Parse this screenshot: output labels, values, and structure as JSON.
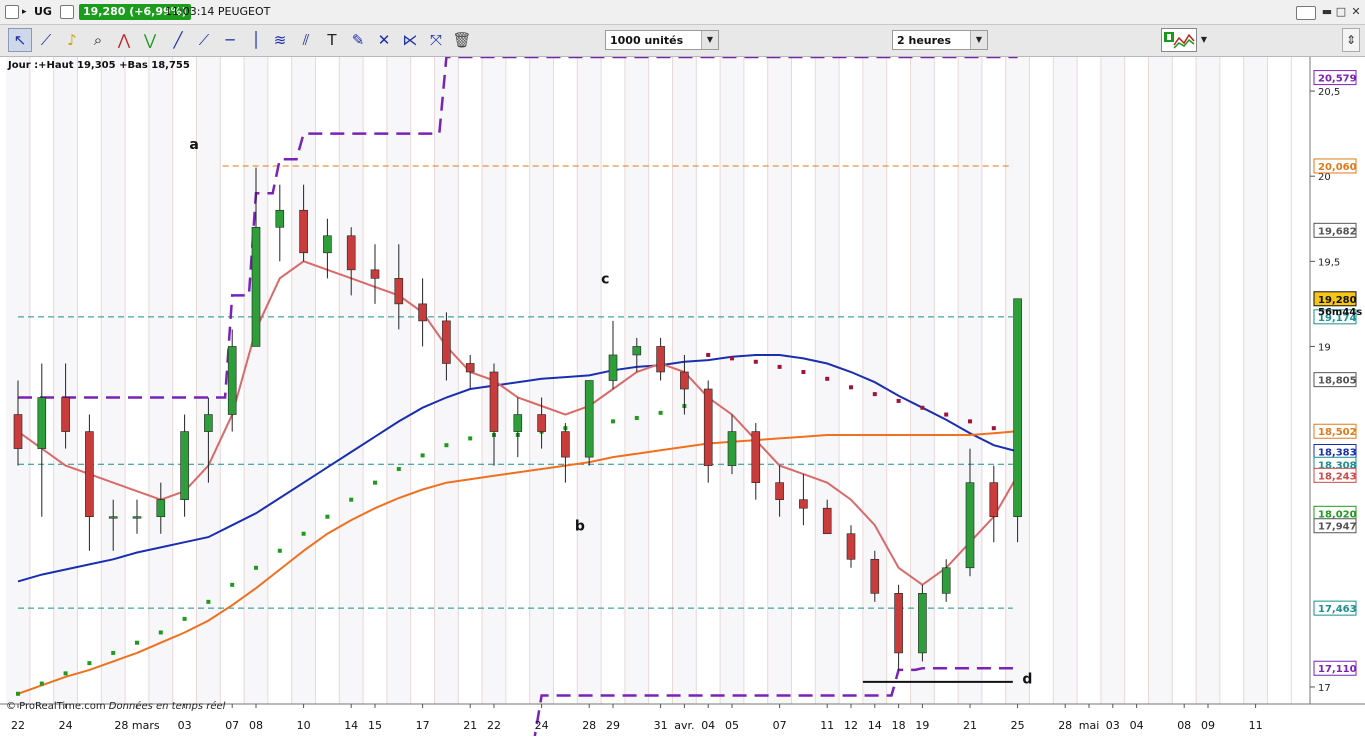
{
  "titlebar": {
    "ticker": "UG",
    "price_badge": "19,280 (+6,99%)",
    "time_name": "11:03:14 PEUGEOT",
    "minimize": "▬",
    "maximize": "□",
    "close": "✕"
  },
  "toolbar": {
    "units_select": "1000 unités",
    "timeframe_select": "2 heures",
    "tools": [
      "cursor-icon",
      "ruler-icon",
      "alarm-bell-icon",
      "zoom-icon",
      "zigzag-red-icon",
      "zigzag-green-icon",
      "line-icon",
      "ray-icon",
      "horizontal-line-icon",
      "vertical-line-icon",
      "fibonacci-icon",
      "parallel-channel-icon",
      "text-icon",
      "pencil-icon",
      "eraser-icon",
      "fan-icon",
      "trash-icon"
    ]
  },
  "header": {
    "info": "Jour :+Haut 19,305 +Bas 18,755",
    "copyright": "© ProRealTime.com",
    "copyright_note": "Données en temps réel",
    "countdown": "56m44s"
  },
  "chart_data": {
    "type": "candlestick",
    "title": "",
    "ylim": [
      16.9,
      20.7
    ],
    "yticks": [
      {
        "value": 17,
        "label": "17"
      },
      {
        "value": 19,
        "label": "19"
      },
      {
        "value": 19.5,
        "label": "19,5"
      },
      {
        "value": 20,
        "label": "20"
      },
      {
        "value": 20.5,
        "label": "20,5"
      }
    ],
    "xlabels": [
      {
        "label": "22",
        "x": 0
      },
      {
        "label": "24",
        "x": 2
      },
      {
        "label": "28 mars",
        "x": 5
      },
      {
        "label": "03",
        "x": 7
      },
      {
        "label": "07",
        "x": 9
      },
      {
        "label": "08",
        "x": 10
      },
      {
        "label": "10",
        "x": 12
      },
      {
        "label": "14",
        "x": 14
      },
      {
        "label": "15",
        "x": 15
      },
      {
        "label": "17",
        "x": 17
      },
      {
        "label": "21",
        "x": 19
      },
      {
        "label": "22",
        "x": 20
      },
      {
        "label": "24",
        "x": 22
      },
      {
        "label": "28",
        "x": 24
      },
      {
        "label": "29",
        "x": 25
      },
      {
        "label": "31",
        "x": 27
      },
      {
        "label": "avr.",
        "x": 28
      },
      {
        "label": "04",
        "x": 29
      },
      {
        "label": "05",
        "x": 30
      },
      {
        "label": "07",
        "x": 32
      },
      {
        "label": "11",
        "x": 34
      },
      {
        "label": "12",
        "x": 35
      },
      {
        "label": "14",
        "x": 36
      },
      {
        "label": "18",
        "x": 37
      },
      {
        "label": "19",
        "x": 38
      },
      {
        "label": "21",
        "x": 40
      },
      {
        "label": "25",
        "x": 42
      },
      {
        "label": "28",
        "x": 44
      },
      {
        "label": "mai",
        "x": 45
      },
      {
        "label": "03",
        "x": 46
      },
      {
        "label": "04",
        "x": 47
      },
      {
        "label": "08",
        "x": 49
      },
      {
        "label": "09",
        "x": 50
      },
      {
        "label": "11",
        "x": 52
      }
    ],
    "price_labels": [
      {
        "value": 20.579,
        "text": "20,579",
        "color": "#7a22b8"
      },
      {
        "value": 20.06,
        "text": "20,060",
        "color": "#e07a18"
      },
      {
        "value": 19.682,
        "text": "19,682",
        "color": "#555555"
      },
      {
        "value": 19.28,
        "text": "19,280",
        "color": "#111111",
        "bg": "#f5c518"
      },
      {
        "value": 19.174,
        "text": "19,174",
        "color": "#1a8f8f"
      },
      {
        "value": 18.805,
        "text": "18,805",
        "color": "#555555"
      },
      {
        "value": 18.502,
        "text": "18,502",
        "color": "#e07a18"
      },
      {
        "value": 18.383,
        "text": "18,383",
        "color": "#1a2fb0"
      },
      {
        "value": 18.308,
        "text": "18,308",
        "color": "#1a8f8f"
      },
      {
        "value": 18.243,
        "text": "18,243",
        "color": "#d04848"
      },
      {
        "value": 18.02,
        "text": "18,020",
        "color": "#1f9a1f"
      },
      {
        "value": 17.947,
        "text": "17,947",
        "color": "#555555"
      },
      {
        "value": 17.463,
        "text": "17,463",
        "color": "#1a8f8f"
      },
      {
        "value": 17.11,
        "text": "17,110",
        "color": "#7a22b8"
      }
    ],
    "annotations": [
      {
        "text": "a",
        "x": 7.2,
        "y": 20.16
      },
      {
        "text": "b",
        "x": 23.4,
        "y": 17.92
      },
      {
        "text": "c",
        "x": 24.5,
        "y": 19.37
      },
      {
        "text": "d",
        "x": 42.2,
        "y": 17.02
      }
    ],
    "support_line": {
      "x0": 35.5,
      "x1": 41.8,
      "y": 17.03
    },
    "horizontal_lines": [
      {
        "y": 20.06,
        "x0": 8.6,
        "x1": 41.8,
        "color": "#e07a18"
      },
      {
        "y": 19.174,
        "x0": 0,
        "x1": 41.8,
        "color": "#1a8f8f"
      },
      {
        "y": 18.308,
        "x0": 0,
        "x1": 41.8,
        "color": "#1a8f8f"
      },
      {
        "y": 17.463,
        "x0": 0,
        "x1": 41.8,
        "color": "#1a8f8f"
      }
    ],
    "candles": [
      [
        18.6,
        18.8,
        18.3,
        18.4
      ],
      [
        18.4,
        18.9,
        18.0,
        18.7
      ],
      [
        18.7,
        18.9,
        18.4,
        18.5
      ],
      [
        18.5,
        18.6,
        17.8,
        18.0
      ],
      [
        18.0,
        18.1,
        17.8,
        18.0
      ],
      [
        18.0,
        18.1,
        17.9,
        18.0
      ],
      [
        18.0,
        18.2,
        17.9,
        18.1
      ],
      [
        18.1,
        18.6,
        18.0,
        18.5
      ],
      [
        18.5,
        18.7,
        18.2,
        18.6
      ],
      [
        18.6,
        19.1,
        18.5,
        19.0
      ],
      [
        19.0,
        20.05,
        19.0,
        19.7
      ],
      [
        19.7,
        19.95,
        19.5,
        19.8
      ],
      [
        19.8,
        19.95,
        19.5,
        19.55
      ],
      [
        19.55,
        19.75,
        19.4,
        19.65
      ],
      [
        19.65,
        19.7,
        19.3,
        19.45
      ],
      [
        19.45,
        19.6,
        19.25,
        19.4
      ],
      [
        19.4,
        19.6,
        19.1,
        19.25
      ],
      [
        19.25,
        19.4,
        19.0,
        19.15
      ],
      [
        19.15,
        19.2,
        18.8,
        18.9
      ],
      [
        18.9,
        18.95,
        18.75,
        18.85
      ],
      [
        18.85,
        18.9,
        18.3,
        18.5
      ],
      [
        18.5,
        18.7,
        18.35,
        18.6
      ],
      [
        18.6,
        18.7,
        18.4,
        18.5
      ],
      [
        18.5,
        18.55,
        18.2,
        18.35
      ],
      [
        18.35,
        18.8,
        18.3,
        18.8
      ],
      [
        18.8,
        19.15,
        18.75,
        18.95
      ],
      [
        18.95,
        19.05,
        18.85,
        19.0
      ],
      [
        19.0,
        19.05,
        18.8,
        18.85
      ],
      [
        18.85,
        18.95,
        18.6,
        18.75
      ],
      [
        18.75,
        18.8,
        18.2,
        18.3
      ],
      [
        18.3,
        18.6,
        18.25,
        18.5
      ],
      [
        18.5,
        18.55,
        18.1,
        18.2
      ],
      [
        18.2,
        18.3,
        18.0,
        18.1
      ],
      [
        18.1,
        18.25,
        17.95,
        18.05
      ],
      [
        18.05,
        18.1,
        17.9,
        17.9
      ],
      [
        17.9,
        17.95,
        17.7,
        17.75
      ],
      [
        17.75,
        17.8,
        17.5,
        17.55
      ],
      [
        17.55,
        17.6,
        17.1,
        17.2
      ],
      [
        17.2,
        17.6,
        17.15,
        17.55
      ],
      [
        17.55,
        17.75,
        17.5,
        17.7
      ],
      [
        17.7,
        18.4,
        17.65,
        18.2
      ],
      [
        18.2,
        18.3,
        17.85,
        18.0
      ],
      [
        18.0,
        19.25,
        17.85,
        19.28
      ]
    ],
    "series": [
      {
        "kind": "ma",
        "color": "#1a2fb0",
        "values": [
          17.62,
          17.66,
          17.69,
          17.72,
          17.75,
          17.79,
          17.82,
          17.85,
          17.88,
          17.95,
          18.02,
          18.11,
          18.2,
          18.29,
          18.38,
          18.47,
          18.56,
          18.64,
          18.7,
          18.75,
          18.77,
          18.79,
          18.81,
          18.82,
          18.83,
          18.86,
          18.88,
          18.89,
          18.91,
          18.92,
          18.94,
          18.95,
          18.95,
          18.93,
          18.9,
          18.85,
          18.79,
          18.71,
          18.64,
          18.57,
          18.49,
          18.42,
          18.383
        ]
      },
      {
        "kind": "ma",
        "color": "#f07020",
        "values": [
          16.96,
          17.01,
          17.06,
          17.1,
          17.15,
          17.2,
          17.26,
          17.32,
          17.39,
          17.48,
          17.58,
          17.69,
          17.8,
          17.9,
          17.98,
          18.05,
          18.11,
          18.16,
          18.2,
          18.22,
          18.24,
          18.26,
          18.28,
          18.3,
          18.32,
          18.35,
          18.37,
          18.39,
          18.41,
          18.43,
          18.44,
          18.45,
          18.46,
          18.47,
          18.48,
          18.48,
          18.48,
          18.48,
          18.48,
          18.48,
          18.48,
          18.49,
          18.502
        ]
      },
      {
        "kind": "ma",
        "color": "#d96a6a",
        "values": [
          18.5,
          18.4,
          18.3,
          18.25,
          18.2,
          18.15,
          18.1,
          18.15,
          18.3,
          18.6,
          19.1,
          19.4,
          19.5,
          19.45,
          19.4,
          19.35,
          19.3,
          19.2,
          19.0,
          18.85,
          18.8,
          18.7,
          18.65,
          18.6,
          18.65,
          18.75,
          18.85,
          18.9,
          18.85,
          18.7,
          18.6,
          18.45,
          18.3,
          18.25,
          18.2,
          18.1,
          17.95,
          17.7,
          17.6,
          17.7,
          17.85,
          18.0,
          18.243
        ]
      },
      {
        "kind": "dotted",
        "color": "#1f9a1f",
        "values": [
          16.96,
          17.02,
          17.08,
          17.14,
          17.2,
          17.26,
          17.32,
          17.4,
          17.5,
          17.6,
          17.7,
          17.8,
          17.9,
          18.0,
          18.1,
          18.2,
          18.28,
          18.36,
          18.42,
          18.46,
          18.48,
          18.48,
          18.5,
          18.52,
          18.54,
          18.56,
          18.58,
          18.61,
          18.65,
          null,
          null,
          null,
          null,
          null,
          null,
          null,
          null,
          null,
          null,
          null,
          null,
          null,
          18.02
        ]
      },
      {
        "kind": "dotted",
        "color": "#a0143c",
        "values": [
          null,
          null,
          null,
          null,
          null,
          null,
          null,
          null,
          null,
          null,
          null,
          null,
          null,
          null,
          null,
          null,
          null,
          null,
          null,
          null,
          null,
          null,
          null,
          null,
          null,
          null,
          null,
          null,
          null,
          18.95,
          18.93,
          18.91,
          18.88,
          18.85,
          18.81,
          18.76,
          18.72,
          18.68,
          18.64,
          18.6,
          18.56,
          18.52,
          18.48
        ]
      },
      {
        "kind": "dashed",
        "color": "#7a22b8",
        "values": [
          18.7,
          18.7,
          18.7,
          18.7,
          18.7,
          18.7,
          18.7,
          18.7,
          18.7,
          19.3,
          19.9,
          20.1,
          20.25,
          20.25,
          20.25,
          20.25,
          20.25,
          20.25,
          20.7,
          20.7,
          20.7,
          20.7,
          20.7,
          20.7,
          20.7,
          20.7,
          20.7,
          20.7,
          20.7,
          20.7,
          20.7,
          20.7,
          20.7,
          20.7,
          20.7,
          20.7,
          20.7,
          20.7,
          20.7,
          20.7,
          20.7,
          20.7,
          20.7
        ]
      },
      {
        "kind": "dashed",
        "color": "#7a22b8",
        "values": [
          null,
          null,
          null,
          null,
          null,
          null,
          null,
          null,
          null,
          null,
          null,
          null,
          null,
          null,
          null,
          null,
          null,
          null,
          null,
          null,
          16.6,
          16.7,
          16.95,
          16.95,
          16.95,
          16.95,
          16.95,
          16.95,
          16.95,
          16.95,
          16.95,
          16.95,
          16.95,
          16.95,
          16.95,
          16.95,
          16.95,
          17.1,
          17.11,
          17.11,
          17.11,
          17.11,
          17.11
        ]
      }
    ]
  }
}
